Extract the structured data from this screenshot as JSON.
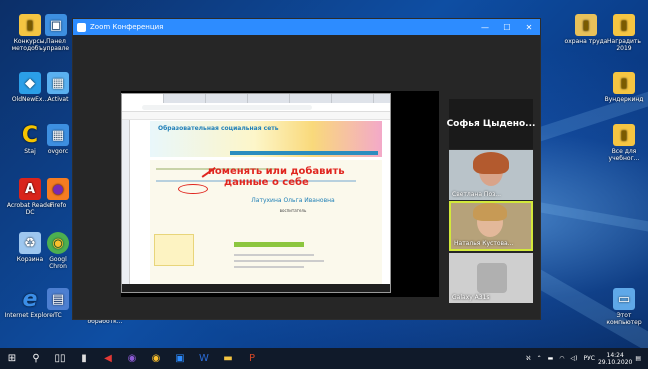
{
  "zoom": {
    "title": "Zoom Конференция",
    "participants": [
      {
        "name": "Софья Цыдено..."
      },
      {
        "name": "Светлана Поз..."
      },
      {
        "name": "Наталья Кустова..."
      },
      {
        "name": "Galaxy A31s"
      }
    ],
    "shared_screen": {
      "tabs": [
        "",
        "",
        "",
        "",
        "",
        ""
      ],
      "address": "",
      "site_title": "Образовательная социальная сеть",
      "annotation_line1": "поменять или добавить",
      "annotation_line2": "данные о себе",
      "person_name": "Латухина Ольга Ивановна",
      "person_role": "воспитатель"
    }
  },
  "desktop": {
    "icons": [
      {
        "label": "Конкурсы, методобъ...",
        "glyph": "▮",
        "color": "#f5c542"
      },
      {
        "label": "Панел управле",
        "glyph": "▣",
        "color": "#3d8fe0"
      },
      {
        "label": "OldNewEx...",
        "glyph": "◆",
        "color": "#2b9fe8"
      },
      {
        "label": "Activat",
        "glyph": "▦",
        "color": "#5ab0f0"
      },
      {
        "label": "Staj",
        "glyph": "C",
        "color": "#f5c400"
      },
      {
        "label": "ovgorc",
        "glyph": "▦",
        "color": "#3d8fe0"
      },
      {
        "label": "Acrobat Reader DC",
        "glyph": "A",
        "color": "#d9241b"
      },
      {
        "label": "Firefo",
        "glyph": "●",
        "color": "#f57c21"
      },
      {
        "label": "Корзина",
        "glyph": "♻",
        "color": "#9ec7ef"
      },
      {
        "label": "Googl Chron",
        "glyph": "◉",
        "color": "#4caf50"
      },
      {
        "label": "Internet Explorer",
        "glyph": "e",
        "color": "#3b8ee8"
      },
      {
        "label": "TC",
        "glyph": "▤",
        "color": "#4d7fd1"
      },
      {
        "label": "охрана труда",
        "glyph": "▮",
        "color": "#e8c15a"
      },
      {
        "label": "Наградить 2019",
        "glyph": "▮",
        "color": "#f5c542"
      },
      {
        "label": "Вундеркинд",
        "glyph": "▮",
        "color": "#f5c542"
      },
      {
        "label": "Все для учебног...",
        "glyph": "▮",
        "color": "#f5c542"
      },
      {
        "label": "Этот компьютер",
        "glyph": "▭",
        "color": "#5fa8e8"
      }
    ],
    "under_label": "обработк..."
  },
  "taskbar": {
    "lang": "РУС",
    "time": "14:24",
    "date": "29.10.2020",
    "tray_a": "ℵ"
  }
}
